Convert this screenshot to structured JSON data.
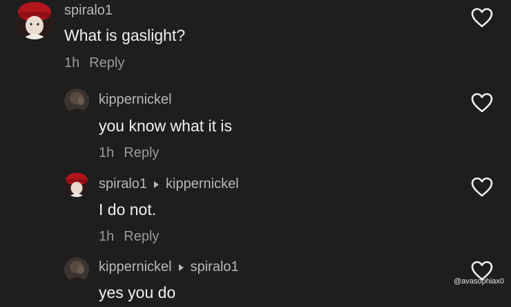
{
  "comments": [
    {
      "username": "spiralo1",
      "text": "What is gaslight?",
      "time": "1h",
      "reply_label": "Reply",
      "avatar": "red-hat-avatar",
      "like_icon": "heart-outline-icon"
    },
    {
      "username": "kippernickel",
      "text": "you know what it is",
      "time": "1h",
      "reply_label": "Reply",
      "avatar": "dark-avatar",
      "like_icon": "heart-outline-icon"
    },
    {
      "username": "spiralo1",
      "reply_to": "kippernickel",
      "text": "I do not.",
      "time": "1h",
      "reply_label": "Reply",
      "avatar": "red-hat-avatar",
      "like_icon": "heart-outline-icon"
    },
    {
      "username": "kippernickel",
      "reply_to": "spiralo1",
      "text": "yes you do",
      "avatar": "dark-avatar",
      "like_icon": "heart-outline-icon"
    }
  ],
  "watermark": "@avasophiax0",
  "colors": {
    "background": "#1e1e1e",
    "username": "#b9b9b9",
    "text": "#f2f2f2",
    "meta": "#9a9a9a"
  }
}
